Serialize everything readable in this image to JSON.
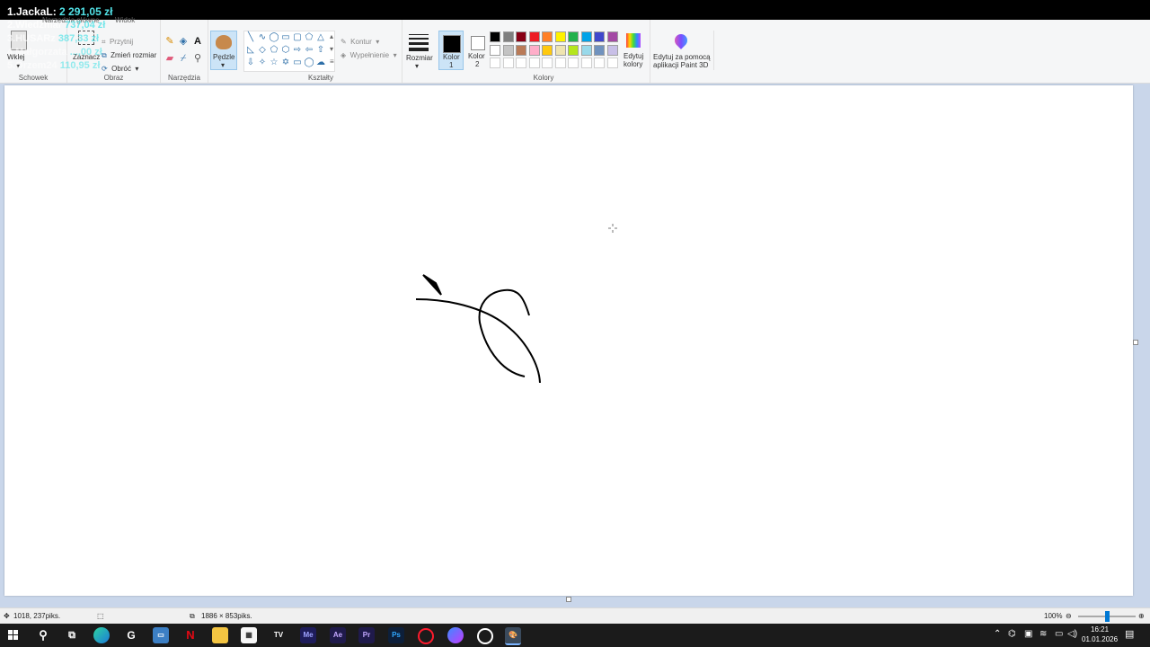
{
  "overlay": {
    "leader": "1.JackaL:",
    "leader_amount": "2 291,05 zł",
    "rows": [
      {
        "name": "2.Wiedźmar",
        "amount": "737,04 zł"
      },
      {
        "name": "3.HUSARz",
        "amount": "387,33 zł"
      },
      {
        "name": "4.Małgorzata",
        "amount": "...,00 zł"
      },
      {
        "name": "5.Orzem24",
        "amount": "110,95 zł"
      }
    ]
  },
  "ribbon": {
    "ghost_tabs": [
      "Narzędzia główne",
      "Widok"
    ],
    "clipboard": {
      "paste_label": "Wklej",
      "group_label": "Schowek"
    },
    "image": {
      "select_label": "Zaznacz",
      "crop_label": "Przytnij",
      "resize_label": "Zmień rozmiar",
      "rotate_label": "Obróć",
      "group_label": "Obraz"
    },
    "tools": {
      "group_label": "Narzędzia"
    },
    "brushes": {
      "label": "Pędzle"
    },
    "shapes": {
      "outline_label": "Kontur",
      "fill_label": "Wypełnienie",
      "group_label": "Kształty"
    },
    "size": {
      "label": "Rozmiar"
    },
    "colors": {
      "color1_label": "Kolor",
      "color1_index": "1",
      "color2_label": "Kolor",
      "color2_index": "2",
      "color1_value": "#000000",
      "color2_value": "#ffffff",
      "edit_label_line1": "Edytuj",
      "edit_label_line2": "kolory",
      "group_label": "Kolory",
      "palette_row1": [
        "#000000",
        "#7f7f7f",
        "#880015",
        "#ed1c24",
        "#ff7f27",
        "#fff200",
        "#22b14c",
        "#00a2e8",
        "#3f48cc",
        "#a349a4"
      ],
      "palette_row2": [
        "#ffffff",
        "#c3c3c3",
        "#b97a57",
        "#ffaec9",
        "#ffc90e",
        "#efe4b0",
        "#b5e61d",
        "#99d9ea",
        "#7092be",
        "#c8bfe7"
      ]
    },
    "paint3d": {
      "line1": "Edytuj za pomocą",
      "line2": "aplikacji Paint 3D"
    }
  },
  "status": {
    "cursor_pos": "1018, 237piks.",
    "image_size": "1886 × 853piks.",
    "zoom": "100%",
    "zoom_level": 1.0
  },
  "taskbar": {
    "time": "16:21",
    "date": "01.01.2026",
    "apps": [
      "windows-start",
      "search",
      "task-view",
      "edge",
      "app-g",
      "store",
      "netflix",
      "file-explorer",
      "ms-store",
      "tradingview",
      "media-encoder",
      "after-effects",
      "premiere-pro",
      "photoshop",
      "opera",
      "messenger",
      "steam",
      "paint"
    ]
  }
}
